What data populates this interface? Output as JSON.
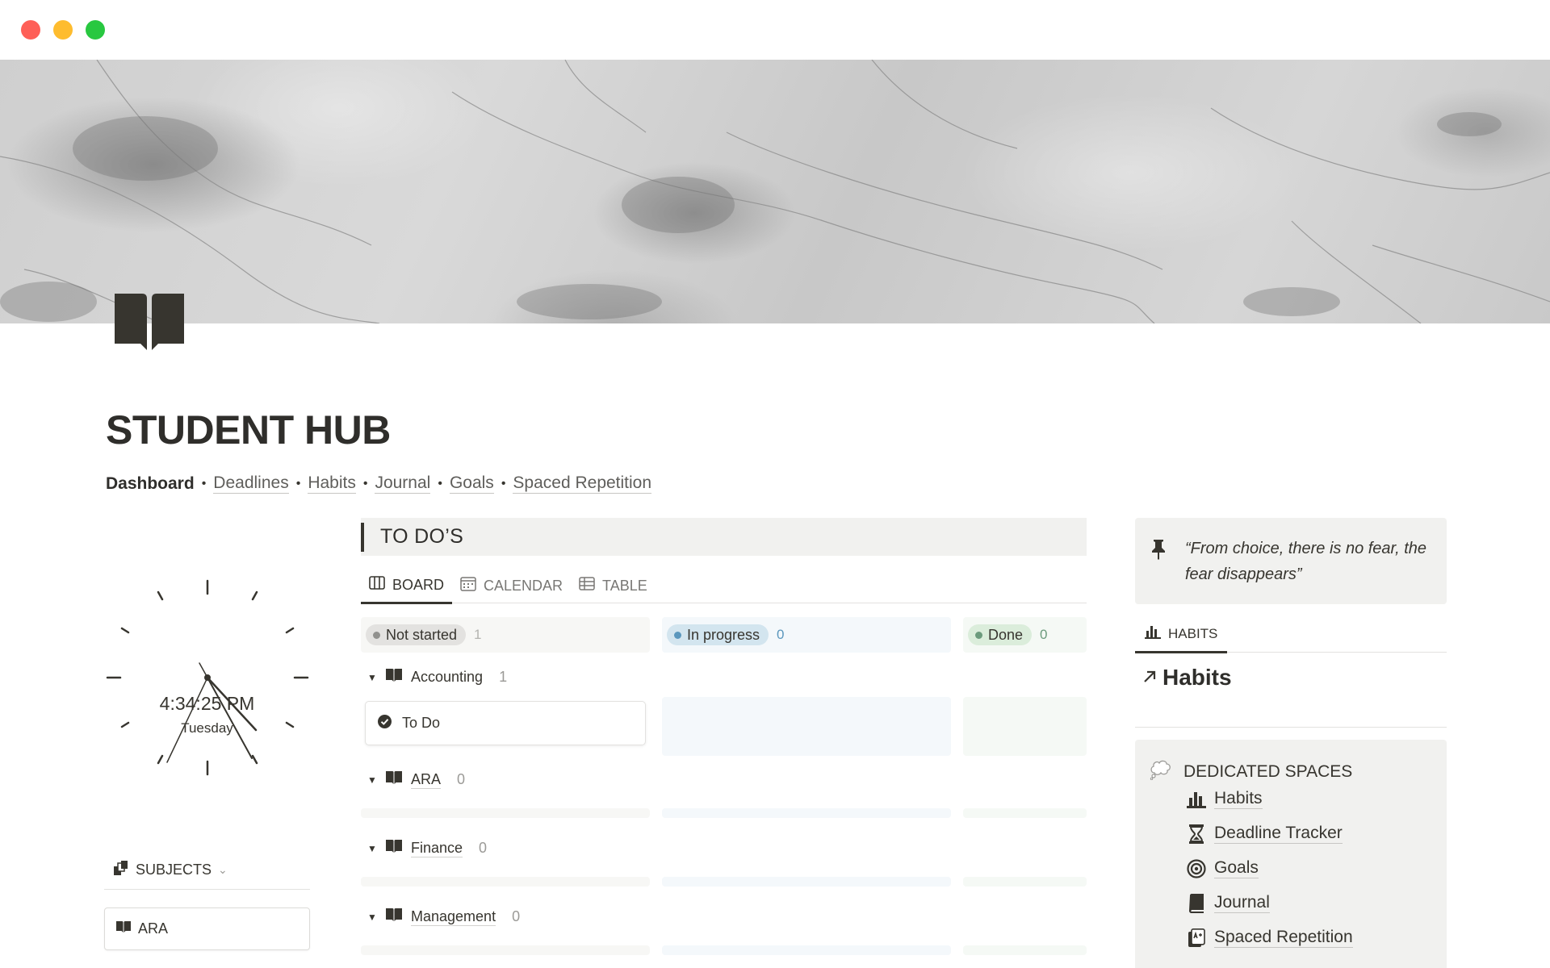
{
  "page": {
    "title": "STUDENT HUB",
    "icon": "book-icon"
  },
  "nav": {
    "current": "Dashboard",
    "links": [
      "Deadlines",
      "Habits",
      "Journal",
      "Goals",
      "Spaced Repetition"
    ],
    "separator": "•"
  },
  "clock": {
    "time": "4:34:25 PM",
    "day": "Tuesday"
  },
  "subjects": {
    "heading": "SUBJECTS",
    "items": [
      "ARA"
    ]
  },
  "todo": {
    "heading": "TO DO’S",
    "tabs": [
      "BOARD",
      "CALENDAR",
      "TABLE"
    ],
    "columns": [
      {
        "label": "Not started",
        "count": "1",
        "dot": "#91918e",
        "pill": "#e3e2e0",
        "bg": "#f7f7f5"
      },
      {
        "label": "In progress",
        "count": "0",
        "dot": "#5b97bd",
        "pill": "#d3e5ef",
        "bg": "#f4f8fb"
      },
      {
        "label": "Done",
        "count": "0",
        "dot": "#6c9b7d",
        "pill": "#dbeddb",
        "bg": "#f5f9f5"
      }
    ],
    "groups": [
      {
        "name": "Accounting",
        "count": "1"
      },
      {
        "name": "ARA",
        "count": "0"
      },
      {
        "name": "Finance",
        "count": "0"
      },
      {
        "name": "Management",
        "count": "0"
      }
    ],
    "card": "To Do"
  },
  "quote": {
    "text": "“From choice, there is no fear, the fear disappears”"
  },
  "habits": {
    "tab": "HABITS",
    "link": "Habits"
  },
  "spaces": {
    "heading": "DEDICATED SPACES",
    "items": [
      {
        "label": "Habits",
        "icon": "bar-chart-icon"
      },
      {
        "label": "Deadline Tracker",
        "icon": "hourglass-icon"
      },
      {
        "label": "Goals",
        "icon": "target-icon"
      },
      {
        "label": "Journal",
        "icon": "notebook-icon"
      },
      {
        "label": "Spaced Repetition",
        "icon": "flashcard-icon"
      }
    ]
  }
}
